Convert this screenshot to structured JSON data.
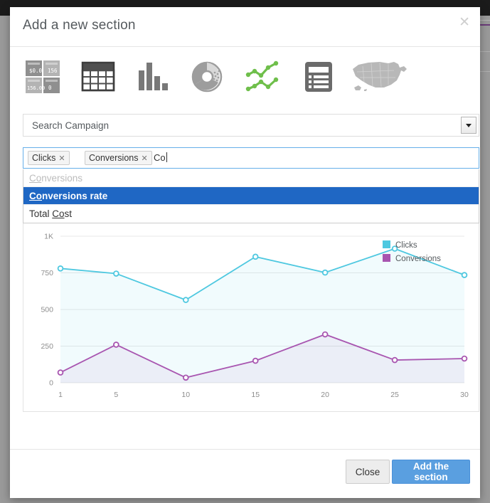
{
  "modal": {
    "title": "Add a new section",
    "close_icon": "close-icon"
  },
  "viz_types": [
    {
      "name": "kpi-tiles",
      "label": "KPI Tiles",
      "selected": false
    },
    {
      "name": "table",
      "label": "Table",
      "selected": false
    },
    {
      "name": "bar-chart",
      "label": "Bar chart",
      "selected": false
    },
    {
      "name": "pie-chart",
      "label": "Pie chart",
      "selected": false
    },
    {
      "name": "line-chart",
      "label": "Line chart",
      "selected": true
    },
    {
      "name": "list-report",
      "label": "List report",
      "selected": false
    },
    {
      "name": "map",
      "label": "Map",
      "selected": false
    }
  ],
  "campaign_select": {
    "value": "Search Campaign",
    "arrow_icon": "chevron-down-icon"
  },
  "metric_input": {
    "tags": [
      {
        "label": "Clicks",
        "remove_icon": "✕"
      },
      {
        "label": "Conversions",
        "remove_icon": "✕"
      }
    ],
    "typed_text": "Co",
    "placeholder": ""
  },
  "autocomplete": {
    "options": [
      {
        "label": "Conversions",
        "match": "Co",
        "rest": "nversions",
        "state": "disabled"
      },
      {
        "label": "Conversions rate",
        "match": "Co",
        "rest": "nversions rate",
        "state": "selected"
      },
      {
        "label": "Total Cost",
        "pre": "Total ",
        "match": "Co",
        "rest": "st",
        "state": "normal"
      }
    ]
  },
  "colors": {
    "clicks": "#4ec8e0",
    "conversions": "#a855b0",
    "highlight": "#1f67c4",
    "primary_button": "#5a9fe0",
    "icon_gray": "#9a9a9a",
    "icon_green": "#6fbf4b"
  },
  "chart_data": {
    "type": "line",
    "title": "",
    "xlabel": "",
    "ylabel": "",
    "x": [
      1,
      5,
      10,
      15,
      20,
      25,
      30
    ],
    "xtick_labels": [
      "1",
      "5",
      "10",
      "15",
      "20",
      "25",
      "30"
    ],
    "ytick_labels": [
      "0",
      "250",
      "500",
      "750",
      "1K"
    ],
    "ytick_values": [
      0,
      250,
      500,
      750,
      1000
    ],
    "ylim": [
      0,
      1000
    ],
    "grid": true,
    "legend_position": "top-right",
    "area_fill": true,
    "series": [
      {
        "name": "Clicks",
        "color": "#4ec8e0",
        "values": [
          780,
          745,
          565,
          860,
          752,
          915,
          735
        ]
      },
      {
        "name": "Conversions",
        "color": "#a855b0",
        "values": [
          70,
          260,
          35,
          150,
          330,
          155,
          165
        ]
      }
    ]
  },
  "footer": {
    "close_label": "Close",
    "add_label": "Add the section"
  }
}
